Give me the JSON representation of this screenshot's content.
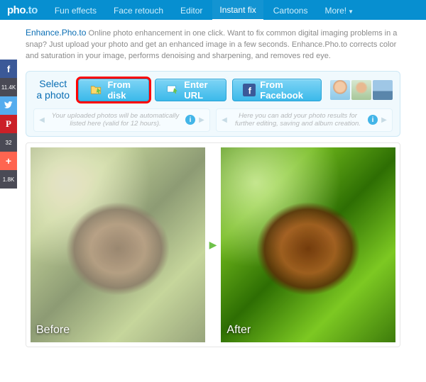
{
  "logo": {
    "a": "pho",
    "b": ".to"
  },
  "nav": {
    "items": [
      {
        "label": "Fun effects"
      },
      {
        "label": "Face retouch"
      },
      {
        "label": "Editor"
      },
      {
        "label": "Instant fix"
      },
      {
        "label": "Cartoons"
      },
      {
        "label": "More!"
      }
    ]
  },
  "desc": {
    "title": "Enhance.Pho.to",
    "body": "Online photo enhancement in one click. Want to fix common digital imaging problems in a snap? Just upload your photo and get an enhanced image in a few seconds. Enhance.Pho.to corrects color and saturation in your image, performs denoising and sharpening, and removes red eye."
  },
  "social": {
    "fb_count": "11.4K",
    "pin_count": "32",
    "add_count": "1.8K"
  },
  "panel": {
    "select_label_a": "Select",
    "select_label_b": "a photo",
    "btn_disk": "From disk",
    "btn_url": "Enter URL",
    "btn_fb": "From Facebook",
    "hint_uploaded": "Your uploaded photos will be automatically listed here (valid for 12 hours).",
    "hint_results": "Here you can add your photo results for further editing, saving and album creation."
  },
  "ba": {
    "before": "Before",
    "after": "After"
  }
}
